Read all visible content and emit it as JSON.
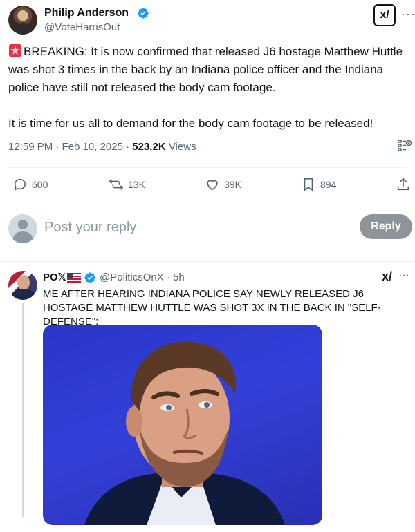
{
  "main_tweet": {
    "author_name": "Philip Anderson",
    "handle": "@VoteHarrisOut",
    "text": "BREAKING: It is now confirmed that released J6 hostage Matthew Huttle was shot 3 times in the back by an Indiana police officer and the Indiana police have still not released the body cam footage.\n\nIt is time for us all to demand for the body cam footage to be released!",
    "timestamp": "12:59 PM · Feb 10, 2025 · ",
    "views_count": "523.2K",
    "views_label": " Views",
    "grok_icon": "grok-icon",
    "more_icon": "more-icon",
    "more_glyph": "···"
  },
  "actions": {
    "replies": "600",
    "reposts": "13K",
    "likes": "39K",
    "bookmarks": "894"
  },
  "reply_box": {
    "placeholder": "Post your reply",
    "button_label": "Reply"
  },
  "reply_tweet": {
    "author_name": "PO𝕏",
    "handle": "@PoliticsOnX · 5h",
    "text": "ME AFTER HEARING INDIANA POLICE SAY NEWLY RELEASED J6 HOSTAGE MATTHEW HUTTLE WAS SHOT 3X IN THE BACK IN \"SELF-DEFENSE\":",
    "more_glyph": "···"
  },
  "colors": {
    "accent": "#1d9bf0",
    "text_primary": "#0f1419",
    "text_secondary": "#536471",
    "reply_button": "#8f9498"
  }
}
